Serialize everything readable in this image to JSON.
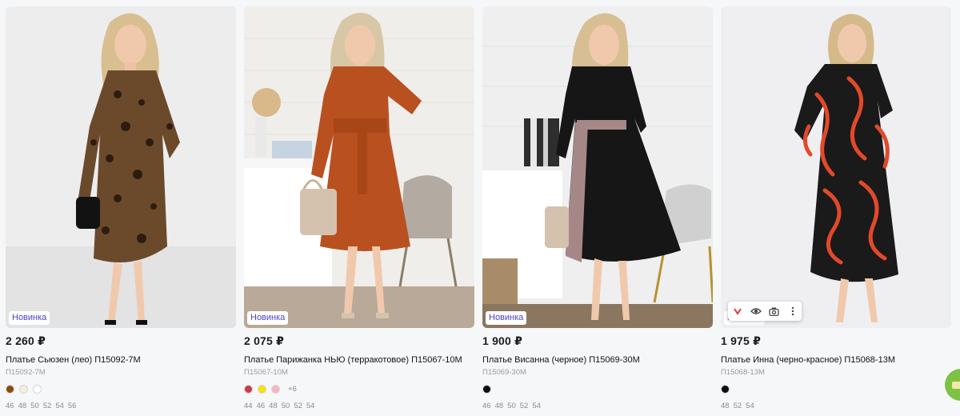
{
  "products": [
    {
      "badge": "Новинка",
      "price": "2 260 ₽",
      "name": "Платье Сьюзен (лео) П15092-7М",
      "sku": "П15092-7М",
      "colors": [
        "#8a4a10",
        "#f3efd8",
        "#ffffff"
      ],
      "more_colors": "",
      "sizes": [
        "46",
        "48",
        "50",
        "52",
        "54",
        "56"
      ]
    },
    {
      "badge": "Новинка",
      "price": "2 075 ₽",
      "name": "Платье Парижанка НЬЮ (терракотовое) П15067-10М",
      "sku": "П15067-10М",
      "colors": [
        "#c83b49",
        "#f7e200",
        "#f4b6c2"
      ],
      "more_colors": "+6",
      "sizes": [
        "44",
        "46",
        "48",
        "50",
        "52",
        "54"
      ]
    },
    {
      "badge": "Новинка",
      "price": "1 900 ₽",
      "name": "Платье Висанна (черное) П15069-30М",
      "sku": "П15069-30М",
      "colors": [
        "#0d0d0d"
      ],
      "more_colors": "",
      "sizes": [
        "46",
        "48",
        "50",
        "52",
        "54"
      ]
    },
    {
      "badge": "Новинка",
      "price": "1 975 ₽",
      "name": "Платье Инна (черно-красное) П15068-13М",
      "sku": "П15068-13М",
      "colors": [
        "#0d0d0d"
      ],
      "more_colors": "",
      "sizes": [
        "48",
        "52",
        "54"
      ]
    }
  ],
  "image_toolbar": {
    "icons": [
      "pin-icon",
      "eye-icon",
      "camera-icon",
      "more-vertical-icon"
    ]
  },
  "colors": {
    "badge_text": "#4b3fce",
    "fab": "#7dc243"
  }
}
